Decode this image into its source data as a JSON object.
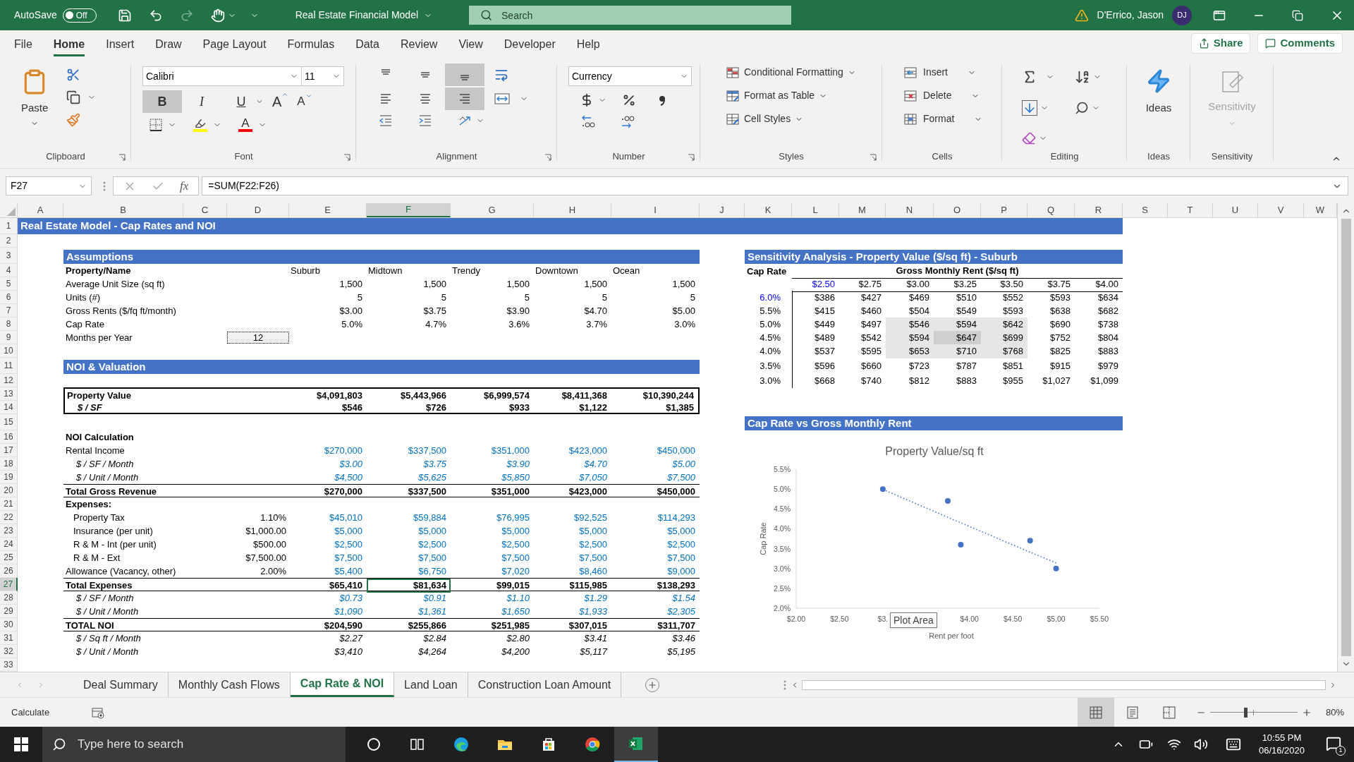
{
  "title_bar": {
    "autosave_label": "AutoSave",
    "autosave": {
      "on": false,
      "label": "Off"
    },
    "title": "Real Estate Financial Model",
    "search": {
      "placeholder": "Search"
    },
    "user": {
      "name": "D'Errico, Jason",
      "initials": "DJ"
    }
  },
  "menu": {
    "tabs": [
      {
        "label": "File",
        "selected": false
      },
      {
        "label": "Home",
        "selected": true
      },
      {
        "label": "Insert",
        "selected": false
      },
      {
        "label": "Draw",
        "selected": false
      },
      {
        "label": "Page Layout",
        "selected": false
      },
      {
        "label": "Formulas",
        "selected": false
      },
      {
        "label": "Data",
        "selected": false
      },
      {
        "label": "Review",
        "selected": false
      },
      {
        "label": "View",
        "selected": false
      },
      {
        "label": "Developer",
        "selected": false
      },
      {
        "label": "Help",
        "selected": false
      }
    ],
    "share": "Share",
    "comments": "Comments"
  },
  "ribbon": {
    "clipboard": {
      "paste": "Paste",
      "label": "Clipboard"
    },
    "font": {
      "font_name": "Calibri",
      "font_size": "11",
      "styles": [
        {
          "label": "B",
          "kind": "bold",
          "selected": true
        },
        {
          "label": "I",
          "kind": "italic",
          "selected": false
        },
        {
          "label": "U",
          "kind": "underline",
          "selected": false
        }
      ],
      "resize": [
        {
          "label": "A",
          "kind": "grow"
        },
        {
          "label": "A",
          "kind": "shrink"
        }
      ],
      "font_color_label": "A",
      "label": "Font"
    },
    "alignment": {
      "vertical": [
        {
          "kind": "top",
          "selected": false
        },
        {
          "kind": "middle",
          "selected": false
        },
        {
          "kind": "bottom",
          "selected": true
        }
      ],
      "horizontal": [
        {
          "kind": "left",
          "selected": false
        },
        {
          "kind": "center",
          "selected": false
        },
        {
          "kind": "right",
          "selected": true
        }
      ],
      "label": "Alignment"
    },
    "number": {
      "format": "Currency",
      "label": "Number"
    },
    "styles": {
      "buttons": [
        {
          "label": "Conditional Formatting",
          "kind": "conditional"
        },
        {
          "label": "Format as Table",
          "kind": "table"
        },
        {
          "label": "Cell Styles",
          "kind": "cellstyles"
        }
      ],
      "label": "Styles"
    },
    "cells": {
      "buttons": [
        {
          "label": "Insert",
          "kind": "insert"
        },
        {
          "label": "Delete",
          "kind": "delete"
        },
        {
          "label": "Format",
          "kind": "format"
        }
      ],
      "label": "Cells"
    },
    "editing": {
      "label": "Editing"
    },
    "ideas": {
      "button": "Ideas",
      "label": "Ideas"
    },
    "sensitivity": {
      "button": "Sensitivity",
      "disabled": true,
      "label": "Sensitivity"
    }
  },
  "formula_bar": {
    "name_box": "F27",
    "fx": "fx",
    "formula": "=SUM(F22:F26)"
  },
  "columns": [
    {
      "label": "A",
      "selected": false
    },
    {
      "label": "B",
      "selected": false
    },
    {
      "label": "C",
      "selected": false
    },
    {
      "label": "D",
      "selected": false
    },
    {
      "label": "E",
      "selected": false
    },
    {
      "label": "F",
      "selected": true
    },
    {
      "label": "G",
      "selected": false
    },
    {
      "label": "H",
      "selected": false
    },
    {
      "label": "I",
      "selected": false
    },
    {
      "label": "J",
      "selected": false
    },
    {
      "label": "K",
      "selected": false
    },
    {
      "label": "L",
      "selected": false
    },
    {
      "label": "M",
      "selected": false
    },
    {
      "label": "N",
      "selected": false
    },
    {
      "label": "O",
      "selected": false
    },
    {
      "label": "P",
      "selected": false
    },
    {
      "label": "Q",
      "selected": false
    },
    {
      "label": "R",
      "selected": false
    },
    {
      "label": "S",
      "selected": false
    },
    {
      "label": "T",
      "selected": false
    },
    {
      "label": "U",
      "selected": false
    },
    {
      "label": "V",
      "selected": false
    },
    {
      "label": "W",
      "selected": false
    }
  ],
  "rows": [
    {
      "label": "1",
      "selected": false
    },
    {
      "label": "2",
      "selected": false
    },
    {
      "label": "3",
      "selected": false
    },
    {
      "label": "4",
      "selected": false
    },
    {
      "label": "5",
      "selected": false
    },
    {
      "label": "6",
      "selected": false
    },
    {
      "label": "7",
      "selected": false
    },
    {
      "label": "8",
      "selected": false
    },
    {
      "label": "9",
      "selected": false
    },
    {
      "label": "10",
      "selected": false
    },
    {
      "label": "11",
      "selected": false
    },
    {
      "label": "12",
      "selected": false
    },
    {
      "label": "13",
      "selected": false
    },
    {
      "label": "14",
      "selected": false
    },
    {
      "label": "15",
      "selected": false
    },
    {
      "label": "16",
      "selected": false
    },
    {
      "label": "17",
      "selected": false
    },
    {
      "label": "18",
      "selected": false
    },
    {
      "label": "19",
      "selected": false
    },
    {
      "label": "20",
      "selected": false
    },
    {
      "label": "21",
      "selected": false
    },
    {
      "label": "22",
      "selected": false
    },
    {
      "label": "23",
      "selected": false
    },
    {
      "label": "24",
      "selected": false
    },
    {
      "label": "25",
      "selected": false
    },
    {
      "label": "26",
      "selected": false
    },
    {
      "label": "27",
      "selected": true
    },
    {
      "label": "28",
      "selected": false
    },
    {
      "label": "29",
      "selected": false
    },
    {
      "label": "30",
      "selected": false
    },
    {
      "label": "31",
      "selected": false
    },
    {
      "label": "32",
      "selected": false
    },
    {
      "label": "33",
      "selected": false
    }
  ],
  "sheet": {
    "title": "Real Estate Model - Cap Rates and NOI",
    "assumptions": {
      "title": "Assumptions",
      "header_label": "Property/Name",
      "properties": [
        "Suburb",
        "Midtown",
        "Trendy",
        "Downtown",
        "Ocean"
      ],
      "rows": [
        {
          "label": "Average Unit Size (sq ft)",
          "values": [
            "1,500",
            "1,500",
            "1,500",
            "1,500",
            "1,500"
          ]
        },
        {
          "label": "Units (#)",
          "values": [
            "5",
            "5",
            "5",
            "5",
            "5"
          ]
        },
        {
          "label": "Gross Rents ($/fq ft/month)",
          "values": [
            "$3.00",
            "$3.75",
            "$3.90",
            "$4.70",
            "$5.00"
          ]
        },
        {
          "label": "Cap Rate",
          "values": [
            "5.0%",
            "4.7%",
            "3.6%",
            "3.7%",
            "3.0%"
          ]
        }
      ],
      "months": {
        "label": "Months per Year",
        "value": "12"
      }
    },
    "noi": {
      "title": "NOI & Valuation",
      "valuation": [
        {
          "label": "Property Value",
          "kind": "primary",
          "values": [
            "$4,091,803",
            "$5,443,966",
            "$6,999,574",
            "$8,411,368",
            "$10,390,244"
          ]
        },
        {
          "label": "$ / SF",
          "kind": "secondary",
          "values": [
            "$546",
            "$726",
            "$933",
            "$1,122",
            "$1,385"
          ]
        }
      ],
      "calculation": [
        {
          "label": "NOI Calculation",
          "kind": "heading"
        },
        {
          "label": "Rental Income",
          "kind": "input",
          "values": [
            "$270,000",
            "$337,500",
            "$351,000",
            "$423,000",
            "$450,000"
          ]
        },
        {
          "label": "$ / SF / Month",
          "kind": "derived",
          "values": [
            "$3.00",
            "$3.75",
            "$3.90",
            "$4.70",
            "$5.00"
          ]
        },
        {
          "label": "$ / Unit / Month",
          "kind": "derived",
          "values": [
            "$4,500",
            "$5,625",
            "$5,850",
            "$7,050",
            "$7,500"
          ]
        },
        {
          "label": "Total Gross Revenue",
          "kind": "total",
          "values": [
            "$270,000",
            "$337,500",
            "$351,000",
            "$423,000",
            "$450,000"
          ]
        },
        {
          "label": "Expenses:",
          "kind": "heading",
          "children": [
            {
              "label": "Property Tax",
              "kind": "input",
              "rate": "1.10%",
              "values": [
                "$45,010",
                "$59,884",
                "$76,995",
                "$92,525",
                "$114,293"
              ]
            },
            {
              "label": "Insurance (per unit)",
              "kind": "input",
              "rate": "$1,000.00",
              "values": [
                "$5,000",
                "$5,000",
                "$5,000",
                "$5,000",
                "$5,000"
              ]
            },
            {
              "label": "R & M - Int (per unit)",
              "kind": "input",
              "rate": "$500.00",
              "values": [
                "$2,500",
                "$2,500",
                "$2,500",
                "$2,500",
                "$2,500"
              ]
            },
            {
              "label": "R & M - Ext",
              "kind": "input",
              "rate": "$7,500.00",
              "values": [
                "$7,500",
                "$7,500",
                "$7,500",
                "$7,500",
                "$7,500"
              ]
            }
          ]
        },
        {
          "label": "Allowance (Vacancy, other)",
          "kind": "input",
          "rate": "2.00%",
          "values": [
            "$5,400",
            "$6,750",
            "$7,020",
            "$8,460",
            "$9,000"
          ]
        },
        {
          "label": "Total Expenses",
          "kind": "total",
          "values": [
            "$65,410",
            "$81,634",
            "$99,015",
            "$115,985",
            "$138,293"
          ]
        },
        {
          "label": "$ / SF / Month",
          "kind": "derived",
          "values": [
            "$0.73",
            "$0.91",
            "$1.10",
            "$1.29",
            "$1.54"
          ]
        },
        {
          "label": "$ / Unit / Month",
          "kind": "derived",
          "values": [
            "$1,090",
            "$1,361",
            "$1,650",
            "$1,933",
            "$2,305"
          ]
        },
        {
          "label": "TOTAL NOI",
          "kind": "total",
          "values": [
            "$204,590",
            "$255,866",
            "$251,985",
            "$307,015",
            "$311,707"
          ]
        },
        {
          "label": "$ / Sq ft / Month",
          "kind": "metric",
          "values": [
            "$2.27",
            "$2.84",
            "$2.80",
            "$3.41",
            "$3.46"
          ]
        },
        {
          "label": "$ / Unit / Month",
          "kind": "metric",
          "values": [
            "$3,410",
            "$4,264",
            "$4,200",
            "$5,117",
            "$5,195"
          ]
        }
      ]
    },
    "sensitivity": {
      "title": "Sensitivity Analysis - Property Value ($/sq ft) - Suburb",
      "row_header": "Cap Rate",
      "column_header": "Gross Monthly Rent ($/sq ft)",
      "rents": [
        {
          "text": "$2.50",
          "color": "#0000ff"
        },
        {
          "text": "$2.75",
          "color": "#000000"
        },
        {
          "text": "$3.00",
          "color": "#000000"
        },
        {
          "text": "$3.25",
          "color": "#000000"
        },
        {
          "text": "$3.50",
          "color": "#000000"
        },
        {
          "text": "$3.75",
          "color": "#000000"
        },
        {
          "text": "$4.00",
          "color": "#000000"
        }
      ],
      "rows": [
        {
          "cap_rate": {
            "text": "6.0%",
            "color": "#0000ff"
          },
          "cells": [
            {
              "text": "$386",
              "highlighted": false,
              "selected": false
            },
            {
              "text": "$427",
              "highlighted": false,
              "selected": false
            },
            {
              "text": "$469",
              "highlighted": false,
              "selected": false
            },
            {
              "text": "$510",
              "highlighted": false,
              "selected": false
            },
            {
              "text": "$552",
              "highlighted": false,
              "selected": false
            },
            {
              "text": "$593",
              "highlighted": false,
              "selected": false
            },
            {
              "text": "$634",
              "highlighted": false,
              "selected": false
            }
          ]
        },
        {
          "cap_rate": {
            "text": "5.5%",
            "color": "#000000"
          },
          "cells": [
            {
              "text": "$415",
              "highlighted": false,
              "selected": false
            },
            {
              "text": "$460",
              "highlighted": false,
              "selected": false
            },
            {
              "text": "$504",
              "highlighted": false,
              "selected": false
            },
            {
              "text": "$549",
              "highlighted": false,
              "selected": false
            },
            {
              "text": "$593",
              "highlighted": false,
              "selected": false
            },
            {
              "text": "$638",
              "highlighted": false,
              "selected": false
            },
            {
              "text": "$682",
              "highlighted": false,
              "selected": false
            }
          ]
        },
        {
          "cap_rate": {
            "text": "5.0%",
            "color": "#000000"
          },
          "cells": [
            {
              "text": "$449",
              "highlighted": false,
              "selected": false
            },
            {
              "text": "$497",
              "highlighted": false,
              "selected": false
            },
            {
              "text": "$546",
              "highlighted": true,
              "selected": false
            },
            {
              "text": "$594",
              "highlighted": true,
              "selected": false
            },
            {
              "text": "$642",
              "highlighted": true,
              "selected": false
            },
            {
              "text": "$690",
              "highlighted": false,
              "selected": false
            },
            {
              "text": "$738",
              "highlighted": false,
              "selected": false
            }
          ]
        },
        {
          "cap_rate": {
            "text": "4.5%",
            "color": "#000000"
          },
          "cells": [
            {
              "text": "$489",
              "highlighted": false,
              "selected": false
            },
            {
              "text": "$542",
              "highlighted": false,
              "selected": false
            },
            {
              "text": "$594",
              "highlighted": true,
              "selected": false
            },
            {
              "text": "$647",
              "highlighted": true,
              "selected": true
            },
            {
              "text": "$699",
              "highlighted": true,
              "selected": false
            },
            {
              "text": "$752",
              "highlighted": false,
              "selected": false
            },
            {
              "text": "$804",
              "highlighted": false,
              "selected": false
            }
          ]
        },
        {
          "cap_rate": {
            "text": "4.0%",
            "color": "#000000"
          },
          "cells": [
            {
              "text": "$537",
              "highlighted": false,
              "selected": false
            },
            {
              "text": "$595",
              "highlighted": false,
              "selected": false
            },
            {
              "text": "$653",
              "highlighted": true,
              "selected": false
            },
            {
              "text": "$710",
              "highlighted": true,
              "selected": false
            },
            {
              "text": "$768",
              "highlighted": true,
              "selected": false
            },
            {
              "text": "$825",
              "highlighted": false,
              "selected": false
            },
            {
              "text": "$883",
              "highlighted": false,
              "selected": false
            }
          ]
        },
        {
          "cap_rate": {
            "text": "3.5%",
            "color": "#000000"
          },
          "cells": [
            {
              "text": "$596",
              "highlighted": false,
              "selected": false
            },
            {
              "text": "$660",
              "highlighted": false,
              "selected": false
            },
            {
              "text": "$723",
              "highlighted": false,
              "selected": false
            },
            {
              "text": "$787",
              "highlighted": false,
              "selected": false
            },
            {
              "text": "$851",
              "highlighted": false,
              "selected": false
            },
            {
              "text": "$915",
              "highlighted": false,
              "selected": false
            },
            {
              "text": "$979",
              "highlighted": false,
              "selected": false
            }
          ]
        },
        {
          "cap_rate": {
            "text": "3.0%",
            "color": "#000000"
          },
          "cells": [
            {
              "text": "$668",
              "highlighted": false,
              "selected": false
            },
            {
              "text": "$740",
              "highlighted": false,
              "selected": false
            },
            {
              "text": "$812",
              "highlighted": false,
              "selected": false
            },
            {
              "text": "$883",
              "highlighted": false,
              "selected": false
            },
            {
              "text": "$955",
              "highlighted": false,
              "selected": false
            },
            {
              "text": "$1,027",
              "highlighted": false,
              "selected": false
            },
            {
              "text": "$1,099",
              "highlighted": false,
              "selected": false
            }
          ]
        }
      ]
    },
    "chart_section": {
      "title": "Cap Rate vs Gross Monthly Rent",
      "tooltip": "Plot Area",
      "chart_data": {
        "type": "scatter",
        "title": "Property Value/sq ft",
        "xlabel": "Rent per foot",
        "ylabel": "Cap Rate",
        "x": [
          3.0,
          3.75,
          3.9,
          4.7,
          5.0
        ],
        "series": [
          {
            "color": "#4472c4",
            "values": [
              0.05,
              0.047,
              0.036,
              0.037,
              0.03
            ]
          },
          {
            "type": "line",
            "line_style": "dotted",
            "color": "#4472c4",
            "values": [
              0.0499,
              0.0429,
              0.0415,
              0.0341,
              0.0314
            ]
          }
        ],
        "xlim": [
          2,
          5.5
        ],
        "ylim": [
          0.02,
          0.055
        ],
        "xticks": [
          {
            "value": 2,
            "label": "$2.00"
          },
          {
            "value": 2.5,
            "label": "$2.50"
          },
          {
            "value": 3,
            "label": "$3."
          },
          {
            "value": 4,
            "label": "$4.00"
          },
          {
            "value": 4.5,
            "label": "$4.50"
          },
          {
            "value": 5,
            "label": "$5.00"
          },
          {
            "value": 5.5,
            "label": "$5.50"
          }
        ],
        "yticks": [
          {
            "value": 0.02,
            "label": "2.0%"
          },
          {
            "value": 0.025,
            "label": "2.5%"
          },
          {
            "value": 0.03,
            "label": "3.0%"
          },
          {
            "value": 0.035,
            "label": "3.5%"
          },
          {
            "value": 0.04,
            "label": "4.0%"
          },
          {
            "value": 0.045,
            "label": "4.5%"
          },
          {
            "value": 0.05,
            "label": "5.0%"
          },
          {
            "value": 0.055,
            "label": "5.5%"
          }
        ]
      }
    }
  },
  "sheet_tabs": {
    "tabs": [
      {
        "label": "Deal Summary",
        "selected": false
      },
      {
        "label": "Monthly Cash Flows",
        "selected": false
      },
      {
        "label": "Cap Rate & NOI",
        "selected": true
      },
      {
        "label": "Land Loan",
        "selected": false
      },
      {
        "label": "Construction Loan Amount",
        "selected": false
      }
    ]
  },
  "status_bar": {
    "mode": "Calculate",
    "views": [
      {
        "kind": "normal",
        "selected": true
      },
      {
        "kind": "layout",
        "selected": false
      },
      {
        "kind": "break",
        "selected": false
      }
    ],
    "zoom": {
      "level": 0.4,
      "label": "80%"
    }
  },
  "taskbar": {
    "search": {
      "placeholder": "Type here to search"
    },
    "apps": [
      {
        "kind": "cortana",
        "selected": false
      },
      {
        "kind": "taskview",
        "selected": false
      },
      {
        "kind": "edge",
        "selected": false
      },
      {
        "kind": "explorer",
        "selected": false
      },
      {
        "kind": "store",
        "selected": false
      },
      {
        "kind": "chrome",
        "selected": false
      },
      {
        "kind": "excel",
        "selected": true
      }
    ],
    "time": "10:55 PM",
    "date": "06/16/2020",
    "notifications": "1"
  }
}
